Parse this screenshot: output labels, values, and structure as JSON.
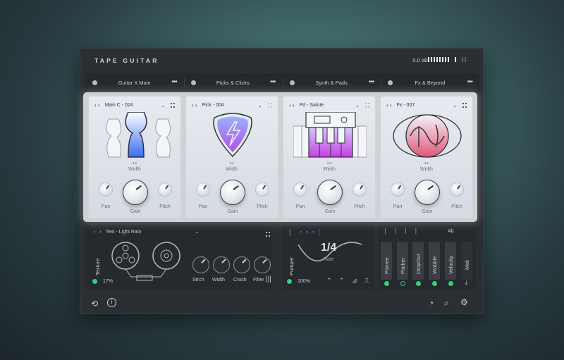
{
  "header": {
    "title": "TAPE GUITAR",
    "output_level": "0.0 dB"
  },
  "tabs": [
    {
      "label": "Guitar X Main"
    },
    {
      "label": "Picks & Clicks"
    },
    {
      "label": "Synth & Pads"
    },
    {
      "label": "Fx & Beyond"
    }
  ],
  "cards": [
    {
      "preset": "Main C - 024",
      "width": "Width",
      "pan": "Pan",
      "gain": "Gain",
      "pitch": "Pitch"
    },
    {
      "preset": "Pick - 004",
      "width": "Width",
      "pan": "Pan",
      "gain": "Gain",
      "pitch": "Pitch"
    },
    {
      "preset": "Pd - Salute",
      "width": "Width",
      "pan": "Pan",
      "gain": "Gain",
      "pitch": "Pitch"
    },
    {
      "preset": "Fx - 007",
      "width": "Width",
      "pan": "Pan",
      "gain": "Gain",
      "pitch": "Pitch"
    }
  ],
  "texture": {
    "preset": "Text - Light Rain",
    "label": "Texture",
    "amount": "17%",
    "knobs": [
      "Strch",
      "Width",
      "Crush",
      "Filter"
    ]
  },
  "pumper": {
    "label": "Pumper",
    "rate_value": "1/4",
    "rate_label": "Rate",
    "amount": "100%"
  },
  "modules": {
    "header_ab": "Ab",
    "items": [
      "Panner",
      "Pitcher",
      "DropOut",
      "Wobble",
      "Velocity",
      "Midi"
    ]
  },
  "colors": {
    "accent_green": "#33d17a",
    "bg_dark": "#2b2e33",
    "gradient_top": "#a7b8ff",
    "gradient_bottom": "#c44ee8",
    "fx_pink": "#e2557a"
  }
}
